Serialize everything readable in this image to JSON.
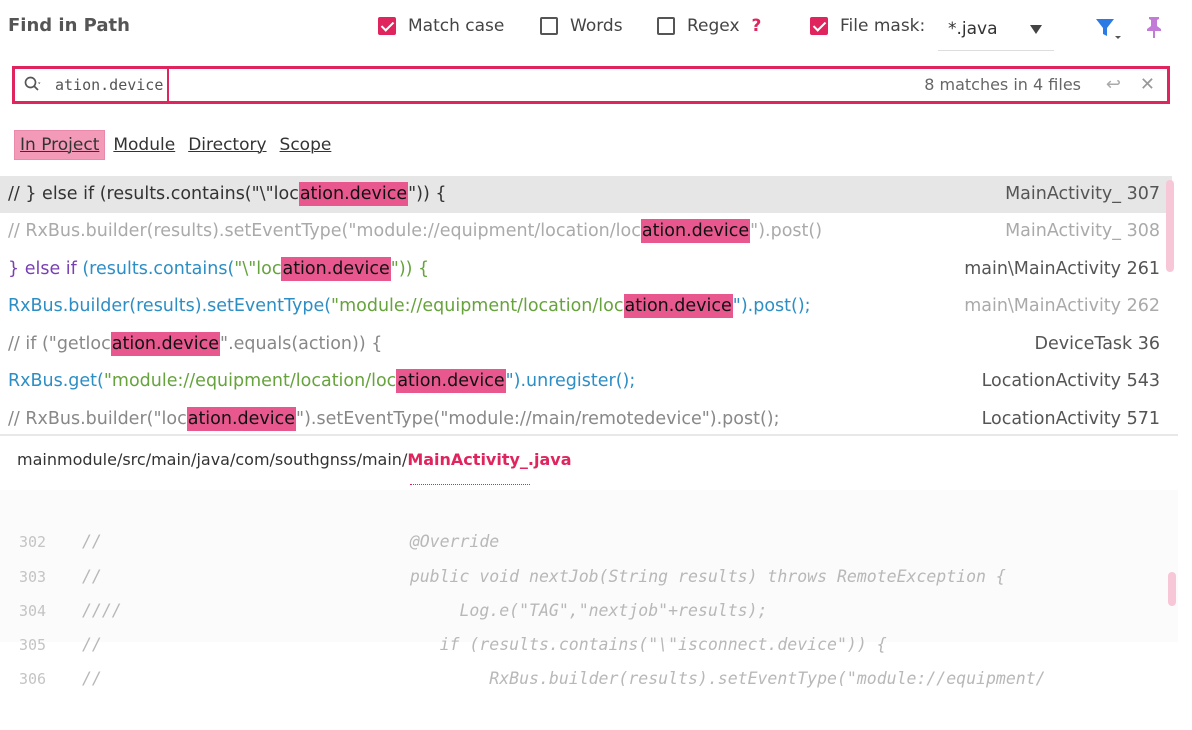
{
  "header": {
    "title": "Find in Path",
    "options": {
      "match_case": {
        "label": "Match case",
        "checked": true
      },
      "words": {
        "label": "Words",
        "checked": false
      },
      "regex": {
        "label": "Regex",
        "checked": false,
        "help": "?"
      },
      "file_mask": {
        "label": "File mask:",
        "checked": true,
        "value": "*.java"
      }
    },
    "icons": [
      "filter-icon",
      "pin-icon"
    ]
  },
  "search": {
    "query": "ation.device",
    "match_count": "8 matches in 4 files",
    "enter_glyph": "↩",
    "clear_glyph": "✕"
  },
  "scopes": [
    {
      "label": "In Project",
      "active": true
    },
    {
      "label": "Module",
      "active": false
    },
    {
      "label": "Directory",
      "active": false
    },
    {
      "label": "Scope",
      "active": false
    }
  ],
  "results": [
    {
      "pre": "//                              } else if (results.contains(\"\\\"loc",
      "match": "ation.device",
      "post": "\")) {",
      "file": "MainActivity_ 307"
    },
    {
      "pre": "//                                   RxBus.builder(results).setEventType(\"module://equipment/location/loc",
      "match": "ation.device",
      "post": "\").post()",
      "file": "MainActivity_ 308"
    },
    {
      "pre_kw": "} else if ",
      "pre": "(results.contains(",
      "pre_str": "\"\\\"loc",
      "match": "ation.device",
      "post": "\")) {",
      "file": "main\\MainActivity 261"
    },
    {
      "pre": "RxBus.builder(results).setEventType(",
      "pre_str": "\"module://equipment/location/loc",
      "match": "ation.device",
      "post": "\").post();",
      "file": "main\\MainActivity 262"
    },
    {
      "pre": "//       if (\"getloc",
      "match": "ation.device",
      "post": "\".equals(action)) {",
      "file": "DeviceTask 36"
    },
    {
      "pre": "RxBus.get(",
      "pre_str": "\"module://equipment/location/loc",
      "match": "ation.device",
      "post": "\").unregister();",
      "file": "LocationActivity 543"
    },
    {
      "pre": "//                 RxBus.builder(\"loc",
      "match": "ation.device",
      "post": "\").setEventType(\"module://main/remotedevice\").post();",
      "file": "LocationActivity 571"
    }
  ],
  "preview": {
    "path_prefix": "mainmodule/src/main/java/com/southgnss/main/",
    "file_name": "MainActivity_.java",
    "lines": [
      {
        "no": "302",
        "text": "//                               @Override"
      },
      {
        "no": "303",
        "text": "//                               public void nextJob(String results) throws RemoteException {"
      },
      {
        "no": "304",
        "text": "////                                  Log.e(\"TAG\",\"nextjob\"+results);"
      },
      {
        "no": "305",
        "text": "//                                  if (results.contains(\"\\\"isconnect.device\")) {"
      },
      {
        "no": "306",
        "text": "//                                       RxBus.builder(results).setEventType(\"module://equipment/"
      }
    ]
  },
  "colors": {
    "accent": "#e0245e",
    "highlight": "#e8588e",
    "filter_icon": "#2c7be5",
    "pin_icon": "#c27bd6"
  }
}
